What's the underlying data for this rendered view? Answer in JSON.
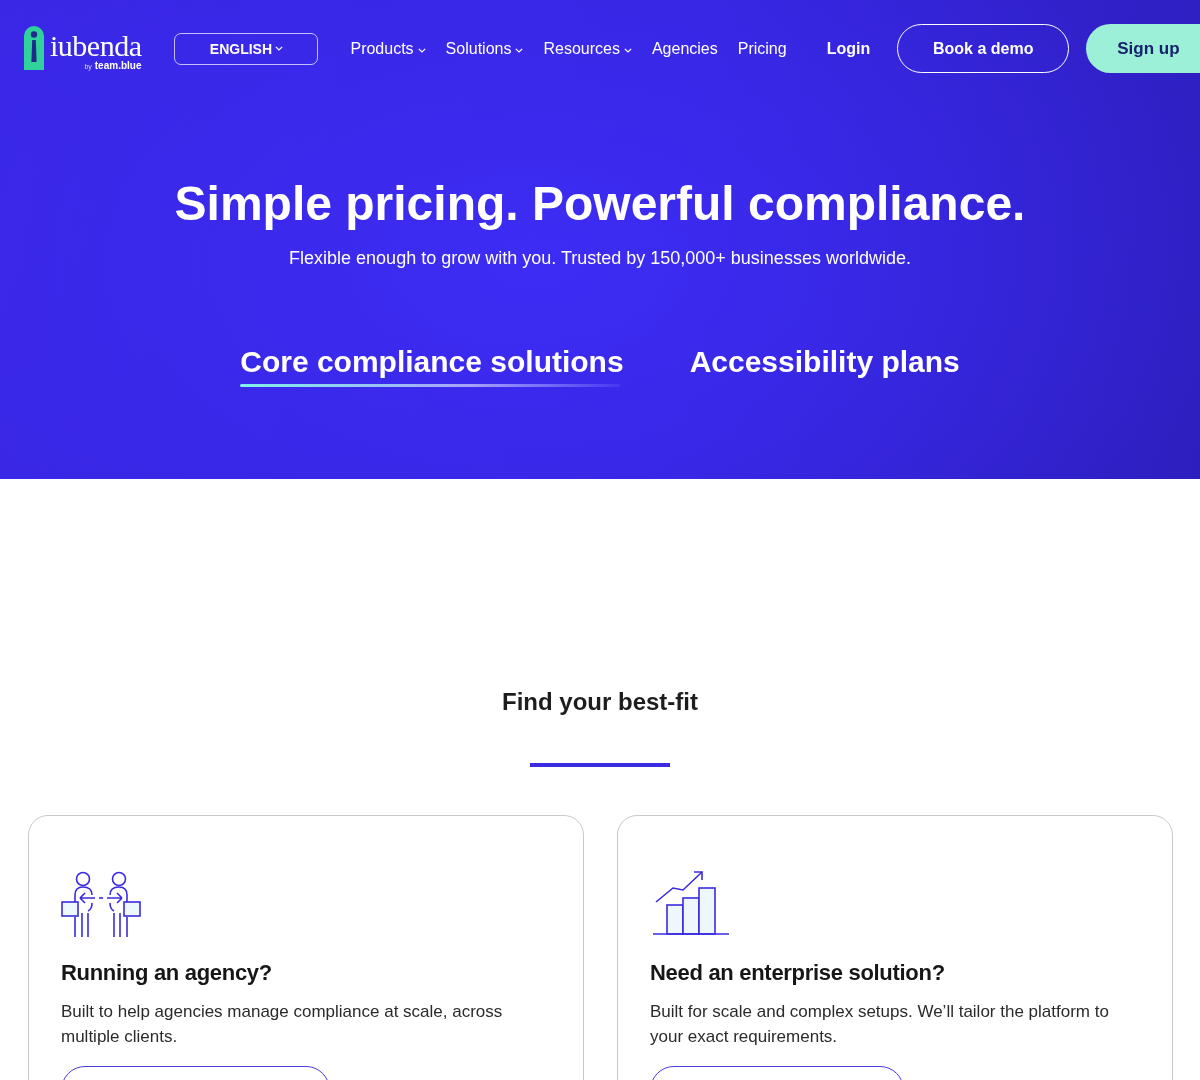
{
  "header": {
    "logo": {
      "wordmark": "iubenda",
      "byline": "by",
      "brand": "team.blue"
    },
    "language": {
      "label": "ENGLISH",
      "has_menu": true
    },
    "nav": [
      {
        "label": "Products",
        "has_menu": true
      },
      {
        "label": "Solutions",
        "has_menu": true
      },
      {
        "label": "Resources",
        "has_menu": true
      },
      {
        "label": "Agencies",
        "has_menu": false
      },
      {
        "label": "Pricing",
        "has_menu": false
      }
    ],
    "login": "Login",
    "actions": [
      {
        "label": "Book a demo",
        "kind": "outline"
      },
      {
        "label": "Sign up",
        "kind": "filled"
      }
    ]
  },
  "hero": {
    "title": "Simple pricing. Powerful compliance.",
    "subtitle": "Flexible enough to grow with you. Trusted by 150,000+ businesses worldwide.",
    "tabs": [
      {
        "label": "Core compliance solutions",
        "selected": true
      },
      {
        "label": "Accessibility plans",
        "selected": false
      }
    ]
  },
  "best_fit": {
    "heading": "Find your best-fit",
    "cards": [
      {
        "kind": "agency",
        "title": "Running an agency?",
        "description": "Built to help agencies manage compliance at scale, across multiple clients."
      },
      {
        "kind": "enterprise",
        "title": "Need an enterprise solution?",
        "description": "Built for scale and complex setups. We’ll tailor the platform to your exact requirements."
      }
    ]
  }
}
